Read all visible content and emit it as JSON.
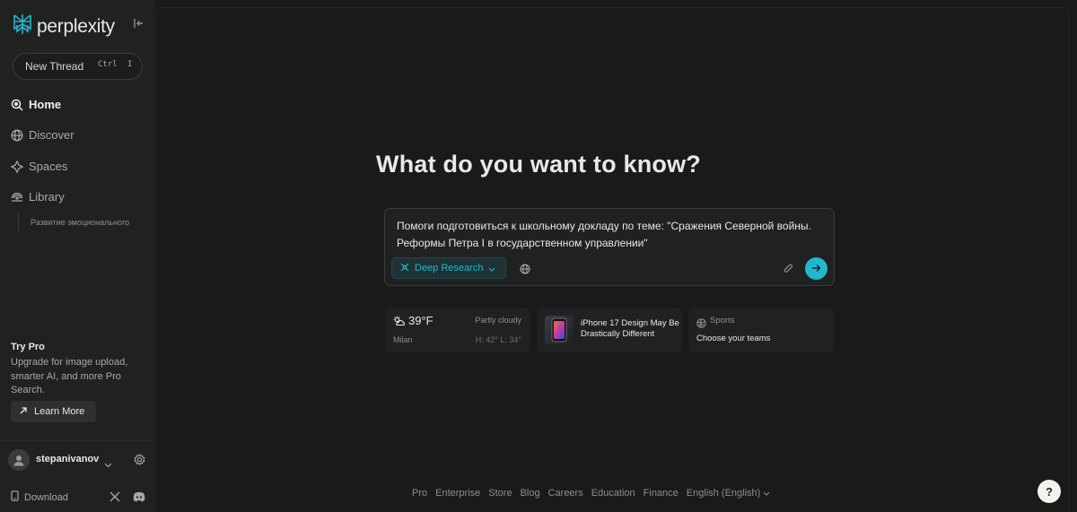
{
  "app": {
    "brand": "perplexity",
    "accent_color": "#20b8cd",
    "background_color": "#191a1a"
  },
  "sidebar": {
    "collapse_icon": "collapse-sidebar-icon",
    "new_thread": {
      "label": "New Thread",
      "shortcut_ctrl": "Ctrl",
      "shortcut_key": "I"
    },
    "nav_items": [
      {
        "label": "Home",
        "icon": "search-icon",
        "active": true
      },
      {
        "label": "Discover",
        "icon": "globe-icon",
        "active": false
      },
      {
        "label": "Spaces",
        "icon": "spaces-icon",
        "active": false
      },
      {
        "label": "Library",
        "icon": "library-icon",
        "active": false
      }
    ],
    "library_items": [
      "Развитие эмоционального"
    ],
    "try_pro": {
      "title": "Try Pro",
      "description": "Upgrade for image upload, smarter AI, and more Pro Search.",
      "button_label": "Learn More"
    },
    "user": {
      "username": "stepanivanov"
    },
    "download_label": "Download"
  },
  "main": {
    "headline": "What do you want to know?",
    "search": {
      "value": "Помоги подготовиться к школьному докладу по теме: \"Сражения Северной войны. Реформы Петра I в государственном управлении\"",
      "mode_label": "Deep Research"
    },
    "cards": {
      "weather": {
        "temperature": "39°F",
        "condition": "Partly cloudy",
        "city": "Milan",
        "high_low": "H: 42° L: 34°"
      },
      "news": {
        "title": "iPhone 17 Design May Be Drastically Different"
      },
      "sports": {
        "label": "Sports",
        "subtitle": "Choose your teams"
      }
    }
  },
  "footer": {
    "links": [
      "Pro",
      "Enterprise",
      "Store",
      "Blog",
      "Careers",
      "Education",
      "Finance"
    ],
    "language": "English (English)",
    "help_label": "?"
  }
}
